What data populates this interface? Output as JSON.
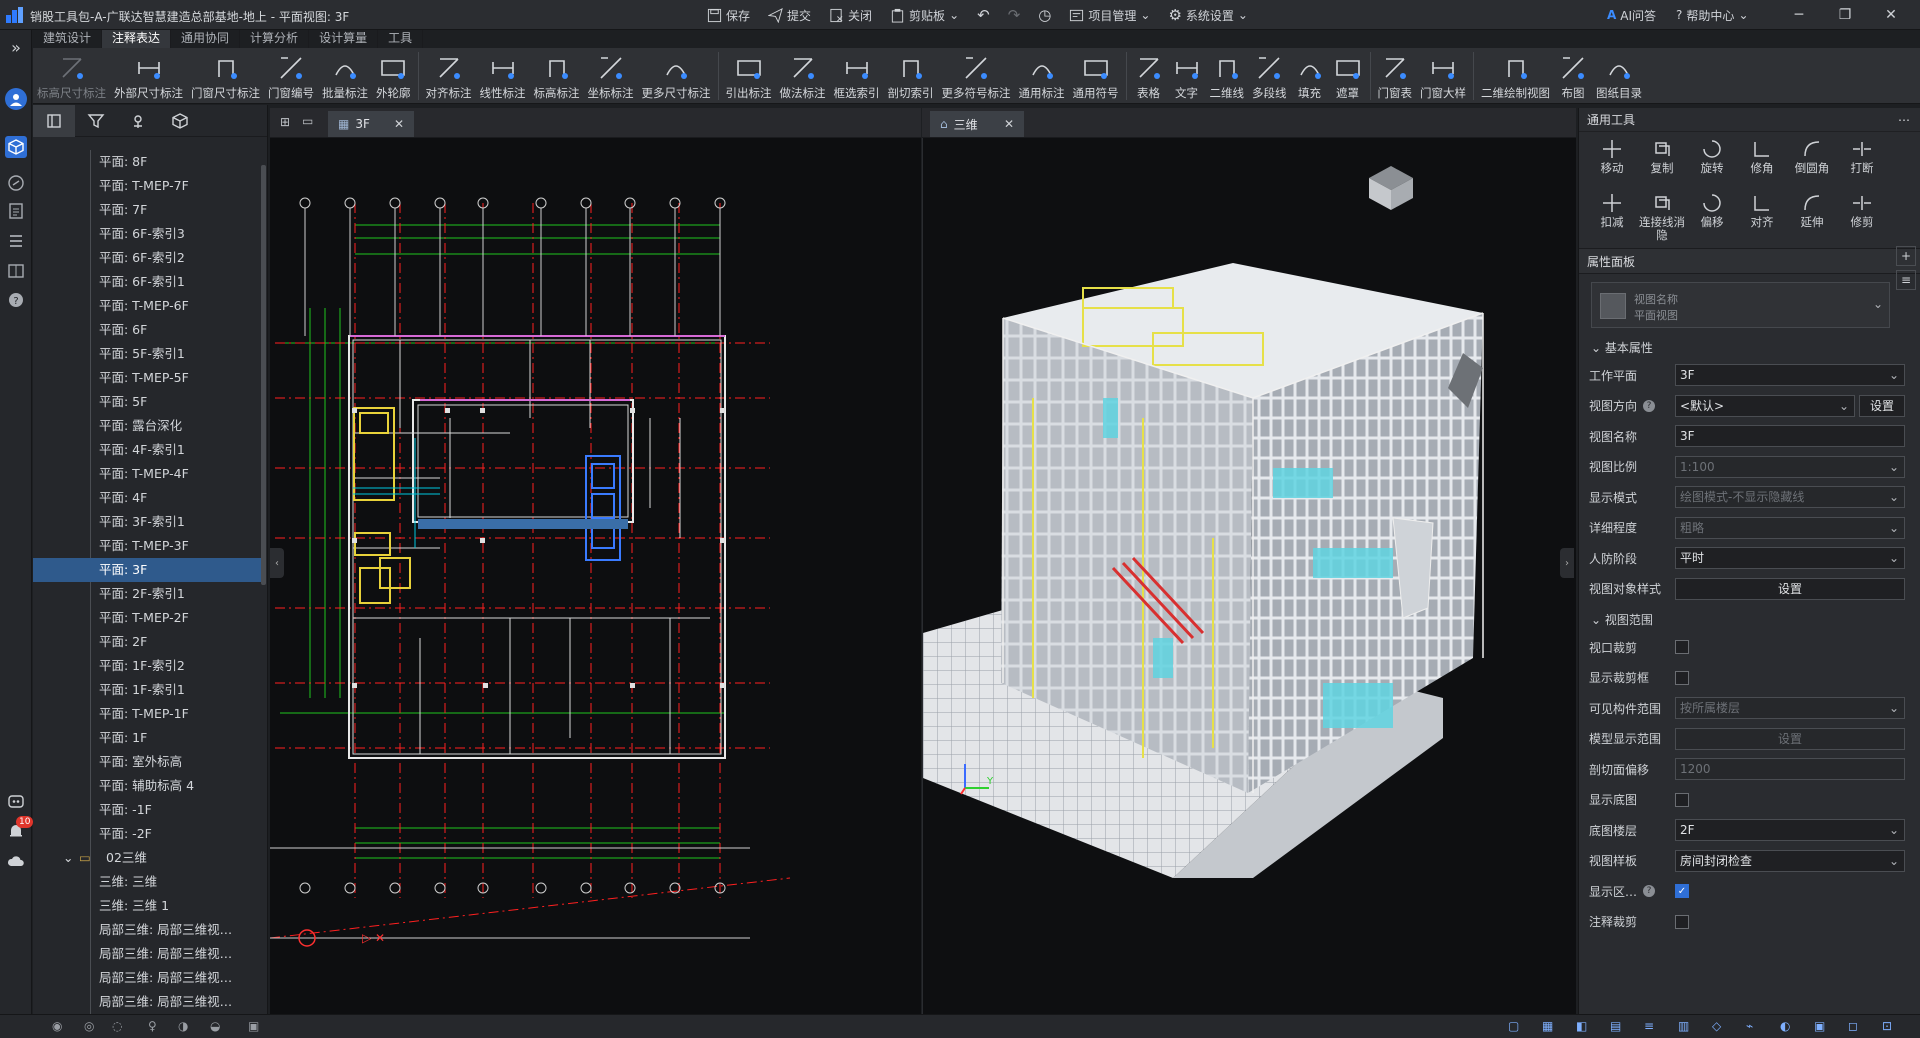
{
  "window": {
    "title": "销股工具包-A-广联达智慧建造总部基地-地上 - 平面视图: 3F",
    "min": "─",
    "max": "❐",
    "close": "✕"
  },
  "toolbar": {
    "save": "保存",
    "submit": "提交",
    "close": "关闭",
    "clipboard": "剪贴板",
    "project": "项目管理",
    "settings": "系统设置",
    "ai": "AI问答",
    "help": "帮助中心"
  },
  "ribbon_tabs": [
    "建筑设计",
    "注释表达",
    "通用协同",
    "计算分析",
    "设计算量",
    "工具"
  ],
  "ribbon_groups": {
    "g1": [
      "标高尺寸标注",
      "外部尺寸标注",
      "门窗尺寸标注",
      "门窗编号",
      "批量标注",
      "外轮廓"
    ],
    "g2": [
      "对齐标注",
      "线性标注",
      "标高标注",
      "坐标标注",
      "更多尺寸标注"
    ],
    "g3": [
      "引出标注",
      "做法标注",
      "框选索引",
      "剖切索引",
      "更多符号标注",
      "通用标注",
      "通用符号"
    ],
    "g4": [
      "表格",
      "文字",
      "二维线",
      "多段线",
      "填充",
      "遮罩"
    ],
    "g5": [
      "门窗表",
      "门窗大样"
    ],
    "g6": [
      "二维绘制视图",
      "布图",
      "图纸目录"
    ]
  },
  "tree": {
    "items": [
      "平面: 8F",
      "平面: T-MEP-7F",
      "平面: 7F",
      "平面: 6F-索引3",
      "平面: 6F-索引2",
      "平面: 6F-索引1",
      "平面: T-MEP-6F",
      "平面: 6F",
      "平面: 5F-索引1",
      "平面: T-MEP-5F",
      "平面: 5F",
      "平面: 露台深化",
      "平面: 4F-索引1",
      "平面: T-MEP-4F",
      "平面: 4F",
      "平面: 3F-索引1",
      "平面: T-MEP-3F",
      "平面: 3F",
      "平面: 2F-索引1",
      "平面: T-MEP-2F",
      "平面: 2F",
      "平面: 1F-索引2",
      "平面: 1F-索引1",
      "平面: T-MEP-1F",
      "平面: 1F",
      "平面: 室外标高",
      "平面: 辅助标高 4",
      "平面: -1F",
      "平面: -2F"
    ],
    "folder": "02三维",
    "items3d": [
      "三维: 三维",
      "三维: 三维 1",
      "局部三维: 局部三维视…",
      "局部三维: 局部三维视…",
      "局部三维: 局部三维视…",
      "局部三维: 局部三维视…"
    ],
    "selected": "平面: 3F"
  },
  "views": {
    "plan_tab": "3F",
    "threed_tab": "三维"
  },
  "right": {
    "tools_title": "通用工具",
    "tools": [
      "移动",
      "复制",
      "旋转",
      "修角",
      "倒圆角",
      "打断",
      "扣减",
      "连接线消隐",
      "偏移",
      "对齐",
      "延伸",
      "修剪"
    ],
    "props_title": "属性面板",
    "viewname_l1": "视图名称",
    "viewname_l2": "平面视图",
    "basic": "基本属性",
    "rows": [
      {
        "label": "工作平面",
        "value": "3F",
        "type": "select"
      },
      {
        "label": "视图方向",
        "value": "<默认>",
        "type": "select-btn",
        "btn": "设置"
      },
      {
        "label": "视图名称",
        "value": "3F",
        "type": "input"
      },
      {
        "label": "视图比例",
        "value": "1:100",
        "type": "select-dis"
      },
      {
        "label": "显示模式",
        "value": "绘图模式-不显示隐藏线",
        "type": "select-dis"
      },
      {
        "label": "详细程度",
        "value": "粗略",
        "type": "select-dis"
      },
      {
        "label": "人防阶段",
        "value": "平时",
        "type": "select"
      },
      {
        "label": "视图对象样式",
        "value": "设置",
        "type": "button"
      }
    ],
    "range": "视图范围",
    "rows2": [
      {
        "label": "视口裁剪",
        "type": "check",
        "on": false
      },
      {
        "label": "显示裁剪框",
        "type": "check",
        "on": false
      },
      {
        "label": "可见构件范围",
        "value": "按所属楼层",
        "type": "select-dis"
      },
      {
        "label": "模型显示范围",
        "value": "设置",
        "type": "button-dis"
      },
      {
        "label": "剖切面偏移",
        "value": "1200",
        "type": "input-dis"
      },
      {
        "label": "显示底图",
        "type": "check",
        "on": false
      },
      {
        "label": "底图楼层",
        "value": "2F",
        "type": "select"
      },
      {
        "label": "视图样板",
        "value": "房间封闭检查",
        "type": "select"
      },
      {
        "label": "显示区…",
        "type": "check",
        "on": true
      },
      {
        "label": "注释裁剪",
        "type": "check",
        "on": false
      }
    ]
  },
  "badge": "10"
}
